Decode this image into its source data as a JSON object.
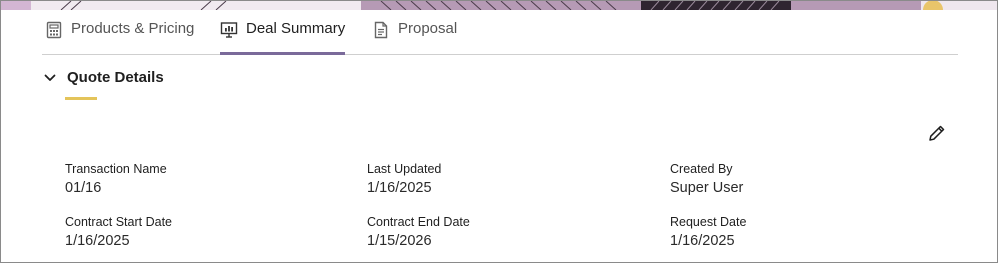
{
  "tabs": [
    {
      "label": "Products & Pricing",
      "icon": "calculator-icon",
      "active": false
    },
    {
      "label": "Deal Summary",
      "icon": "presentation-chart-icon",
      "active": true
    },
    {
      "label": "Proposal",
      "icon": "document-icon",
      "active": false
    }
  ],
  "section": {
    "title": "Quote Details",
    "expanded": true,
    "icon": "chevron-down-icon"
  },
  "edit": {
    "icon": "pencil-icon"
  },
  "fields": [
    {
      "label": "Transaction Name",
      "value": "01/16"
    },
    {
      "label": "Last Updated",
      "value": "1/16/2025"
    },
    {
      "label": "Created By",
      "value": "Super User"
    },
    {
      "label": "Contract Start Date",
      "value": "1/16/2025"
    },
    {
      "label": "Contract End Date",
      "value": "1/15/2026"
    },
    {
      "label": "Request Date",
      "value": "1/16/2025"
    }
  ],
  "colors": {
    "active_tab_indicator": "#7a6a9a",
    "section_accent": "#e4c45a",
    "banner_purple": "#b69ab5"
  }
}
